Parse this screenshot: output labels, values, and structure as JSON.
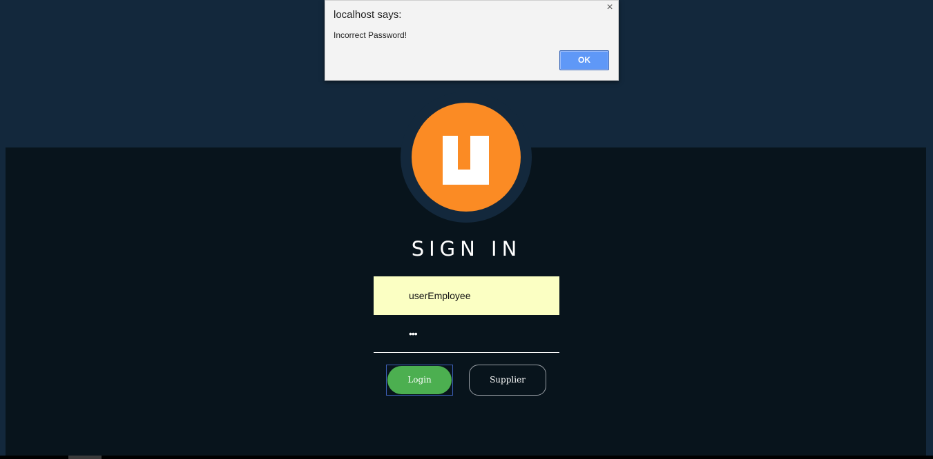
{
  "colors": {
    "page_background": "#13283c",
    "panel_background": "#08141c",
    "logo_orange": "#fb8b24",
    "username_field_bg": "#fbffc3",
    "login_button": "#4caf50",
    "dialog_ok_button": "#5f98f7"
  },
  "logo": {
    "icon": "u-logo-icon"
  },
  "signin": {
    "title": "SIGN IN"
  },
  "form": {
    "username_value": "userEmployee",
    "password_mask": "•••",
    "login_label": "Login",
    "supplier_label": "Supplier"
  },
  "alert": {
    "title": "localhost says:",
    "message": "Incorrect Password!",
    "ok_label": "OK",
    "close_glyph": "×"
  }
}
